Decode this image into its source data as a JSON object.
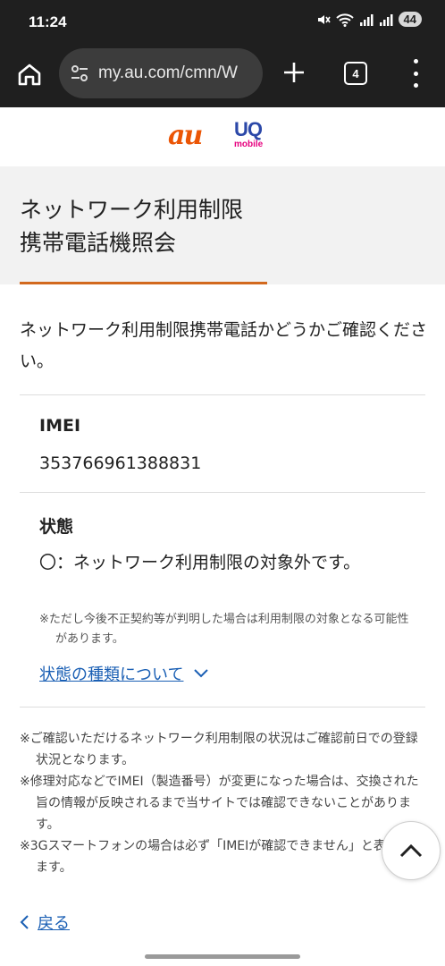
{
  "status_bar": {
    "time": "11:24",
    "battery": "44",
    "icons": [
      "mute-icon",
      "wifi-icon",
      "signal-icon",
      "signal-icon"
    ]
  },
  "browser": {
    "url": "my.au.com/cmn/W",
    "tab_count": "4",
    "icons": [
      "home-icon",
      "site-settings-icon",
      "new-tab-icon",
      "more-menu-icon"
    ]
  },
  "logos": {
    "au": "au",
    "uq_main": "UQ",
    "uq_sub": "mobile",
    "colors": {
      "au": "#eb5505",
      "uq": "#2b48a8",
      "uq_sub": "#e6007e"
    }
  },
  "page": {
    "title_line1": "ネットワーク利用制限",
    "title_line2": "携帯電話機照会",
    "intro": "ネットワーク利用制限携帯電話かどうかご確認ください。",
    "imei_label": "IMEI",
    "imei_value": "353766961388831",
    "status_label": "状態",
    "status_value": "〇：ネットワーク利用制限の対象外です。",
    "status_note": "※ただし今後不正契約等が判明した場合は利用制限の対象となる可能性があります。",
    "types_link": "状態の種類について",
    "footnotes": [
      "※ご確認いただけるネットワーク利用制限の状況はご確認前日での登録状況となります。",
      "※修理対応などでIMEI（製造番号）が変更になった場合は、交換された旨の情報が反映されるまで当サイトでは確認できないことがあります。",
      "※3Gスマートフォンの場合は必ず「IMEIが確認できません」と表記されます。"
    ],
    "back_link": "戻る"
  },
  "colors": {
    "accent_underline": "#d2691e",
    "link": "#1a5fb4"
  }
}
